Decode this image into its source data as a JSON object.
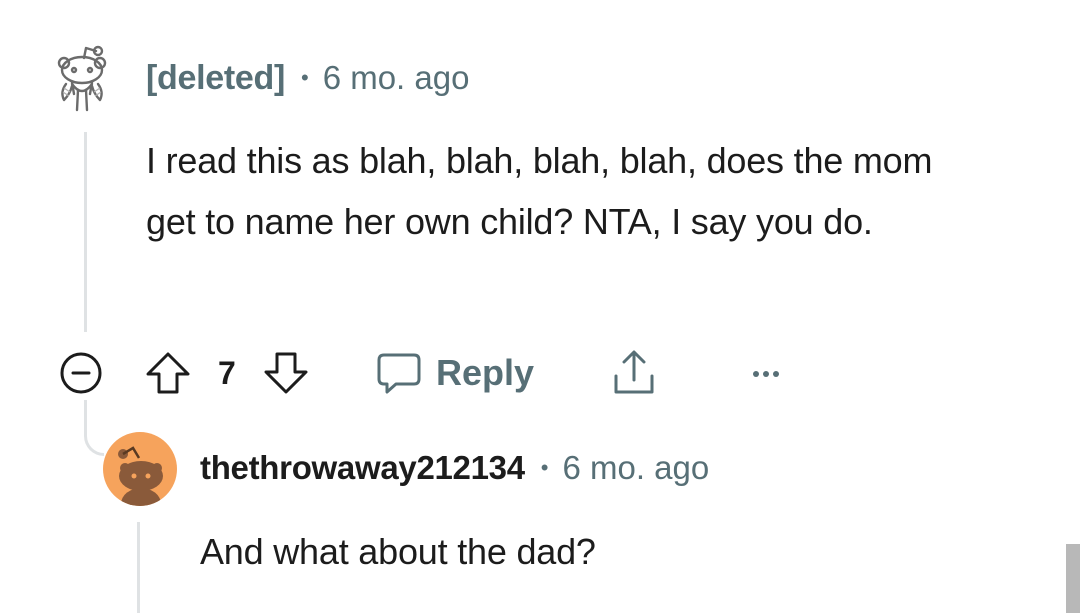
{
  "comments": [
    {
      "author": "[deleted]",
      "separator": "•",
      "time": "6 mo. ago",
      "body": "I read this as blah, blah, blah, blah, does the mom get to name her own child? NTA, I say you do.",
      "avatar_icon": "snoo-deleted-icon",
      "score": "7",
      "reply_label": "Reply",
      "more_label": "•••"
    },
    {
      "author": "thethrowaway212134",
      "separator": "•",
      "time": "6 mo. ago",
      "body": "And what about the dad?",
      "avatar_icon": "snoo-avatar-icon",
      "avatar_color": "#f6a35c"
    }
  ],
  "colors": {
    "text": "#1c1c1c",
    "meta": "#576f76",
    "thread": "#dfe2e4"
  }
}
